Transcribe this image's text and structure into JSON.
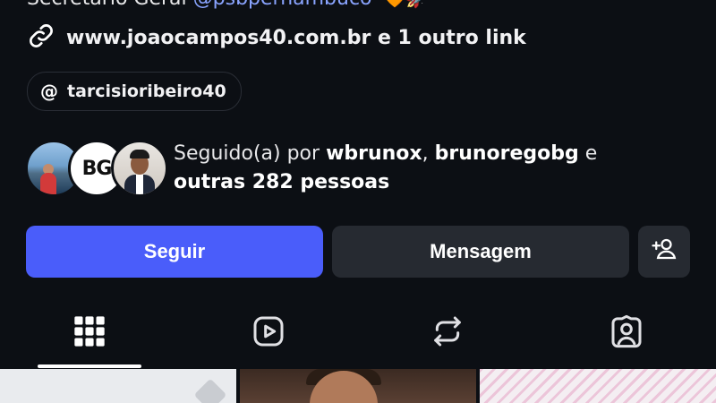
{
  "profile": {
    "bio_partial": "Secretário Geral",
    "bio_mention": "@psbpernambuco",
    "bio_emojis": "🧡🚀",
    "link_text": "www.joaocampos40.com.br e 1 outro link",
    "threads_handle": "tarcisioribeiro40"
  },
  "followed_by": {
    "prefix": "Seguido(a) por",
    "user1": "wbrunox",
    "separator": ",",
    "user2": "brunoregobg",
    "conjunction": "e",
    "others": "outras 282 pessoas",
    "avatar2_text": "BG"
  },
  "actions": {
    "follow_label": "Seguir",
    "message_label": "Mensagem"
  },
  "tabs": [
    {
      "icon": "grid-icon",
      "active": true
    },
    {
      "icon": "reels-icon",
      "active": false
    },
    {
      "icon": "reposts-icon",
      "active": false
    },
    {
      "icon": "tagged-icon",
      "active": false
    }
  ],
  "colors": {
    "background": "#0c0f14",
    "primary_button": "#4a5dfa",
    "secondary_button": "#262a31",
    "mention": "#8aa4ff"
  }
}
